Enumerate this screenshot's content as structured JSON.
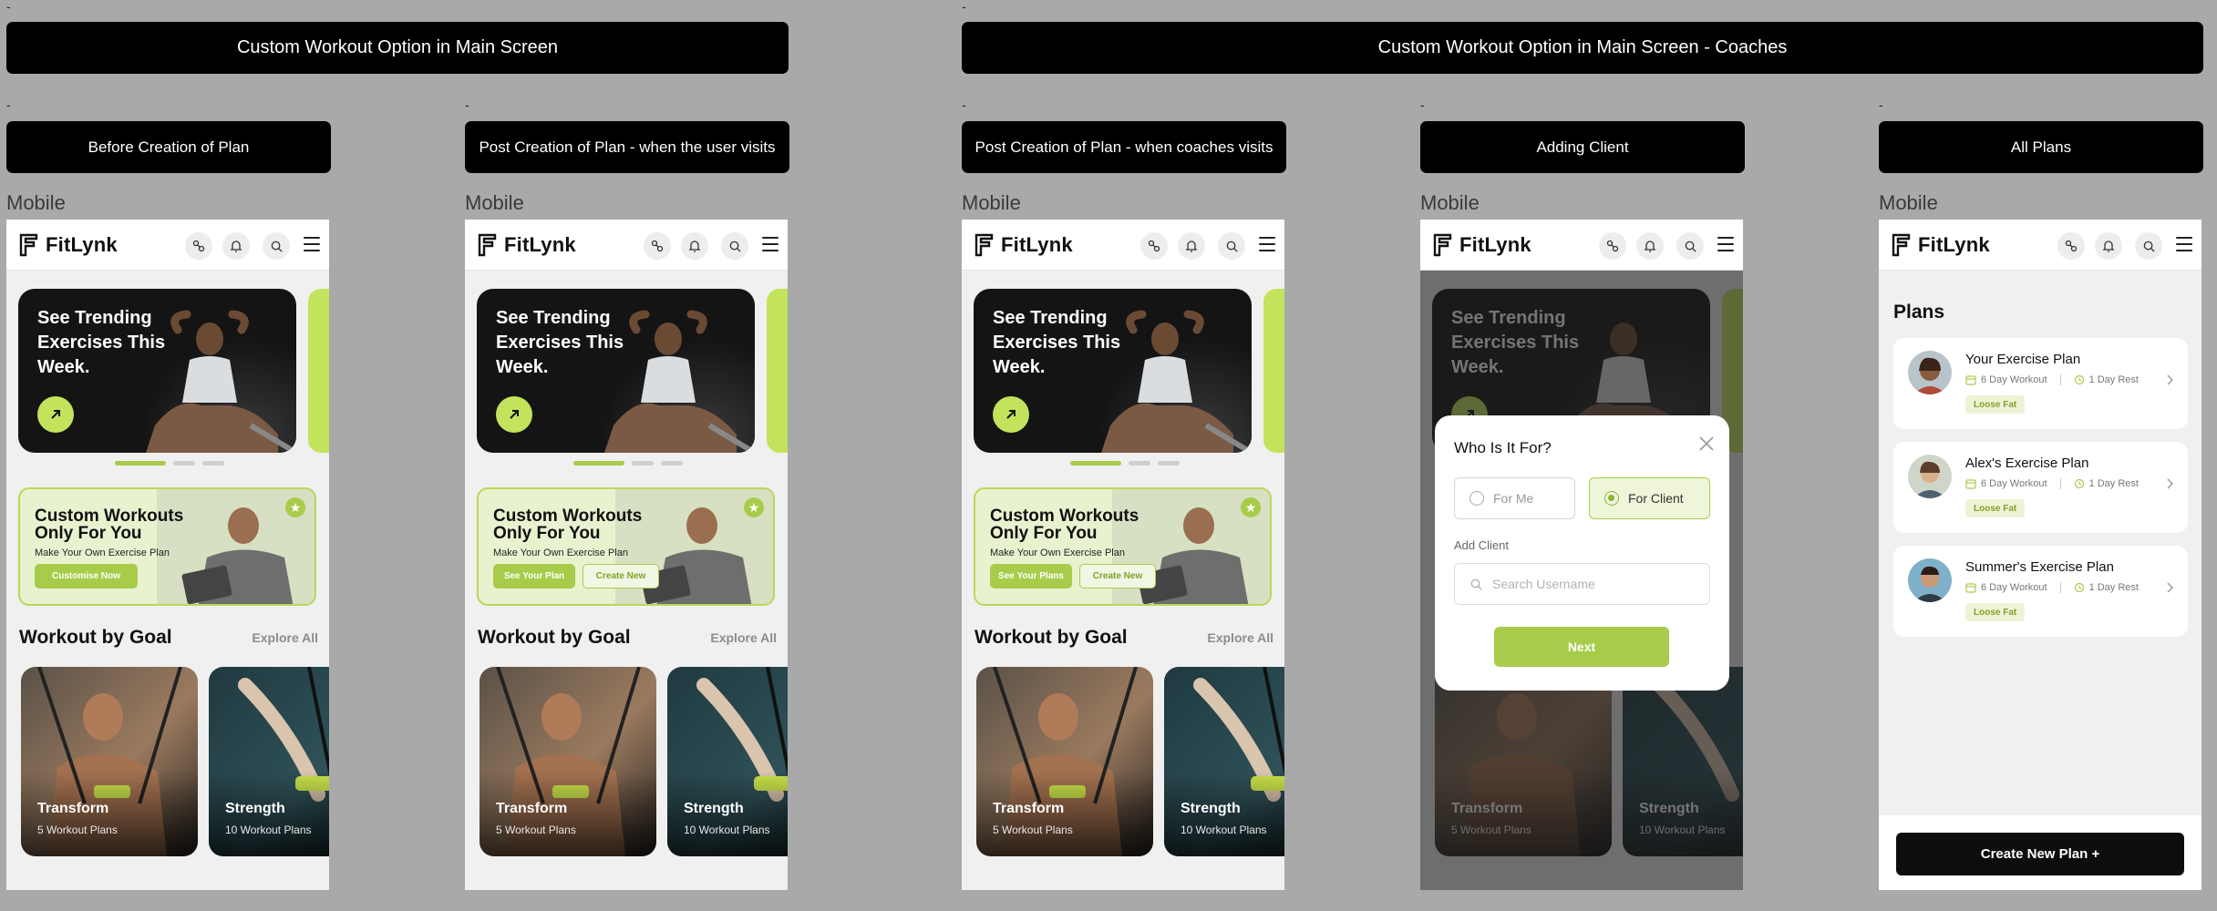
{
  "section_banners": {
    "user": "Custom Workout Option in Main Screen",
    "coaches": "Custom Workout Option in Main Screen - Coaches"
  },
  "screens": [
    {
      "dash": "-",
      "title": "Before Creation of Plan",
      "device": "Mobile"
    },
    {
      "dash": "-",
      "title": "Post Creation of Plan - when the user visits",
      "device": "Mobile"
    },
    {
      "dash": "-",
      "title": "Post Creation of Plan - when coaches visits",
      "device": "Mobile"
    },
    {
      "dash": "-",
      "title": "Adding Client",
      "device": "Mobile"
    },
    {
      "dash": "-",
      "title": "All Plans",
      "device": "Mobile"
    }
  ],
  "top_dashes": [
    "-",
    "-"
  ],
  "app": {
    "brand": "FitLynk",
    "header_icons": [
      "running-icon",
      "bell-icon",
      "search-icon",
      "menu-icon"
    ]
  },
  "hero": {
    "title": "See Trending Exercises This Week.",
    "button_icon": "arrow-up-right-icon"
  },
  "custom_card": {
    "title": "Custom Workouts Only For You",
    "subtitle": "Make Your Own Exercise Plan",
    "customise_label": "Customise Now",
    "see_plan_label": "See Your Plan",
    "see_plans_label": "See Your Plans",
    "create_label": "Create New",
    "badge_icon": "star-icon"
  },
  "goals": {
    "title": "Workout by Goal",
    "explore": "Explore All",
    "cards": [
      {
        "name": "Transform",
        "count": "5 Workout Plans"
      },
      {
        "name": "Strength",
        "count": "10 Workout Plans"
      }
    ]
  },
  "modal": {
    "title": "Who Is It For?",
    "for_me": "For Me",
    "for_client": "For Client",
    "selected": "For Client",
    "add_client_label": "Add Client",
    "search_placeholder": "Search Username",
    "next_label": "Next"
  },
  "plans": {
    "title": "Plans",
    "items": [
      {
        "name": "Your Exercise Plan",
        "workout": "6 Day Workout",
        "rest": "1 Day Rest",
        "tag": "Loose Fat"
      },
      {
        "name": "Alex's Exercise Plan",
        "workout": "6 Day Workout",
        "rest": "1 Day Rest",
        "tag": "Loose Fat"
      },
      {
        "name": "Summer's Exercise Plan",
        "workout": "6 Day Workout",
        "rest": "1 Day Rest",
        "tag": "Loose Fat"
      }
    ],
    "create_label": "Create New Plan +"
  },
  "colors": {
    "accent": "#a8cc4a",
    "accent_light": "#c3e35c",
    "dark": "#141414",
    "canvas": "#a9a9a9"
  }
}
